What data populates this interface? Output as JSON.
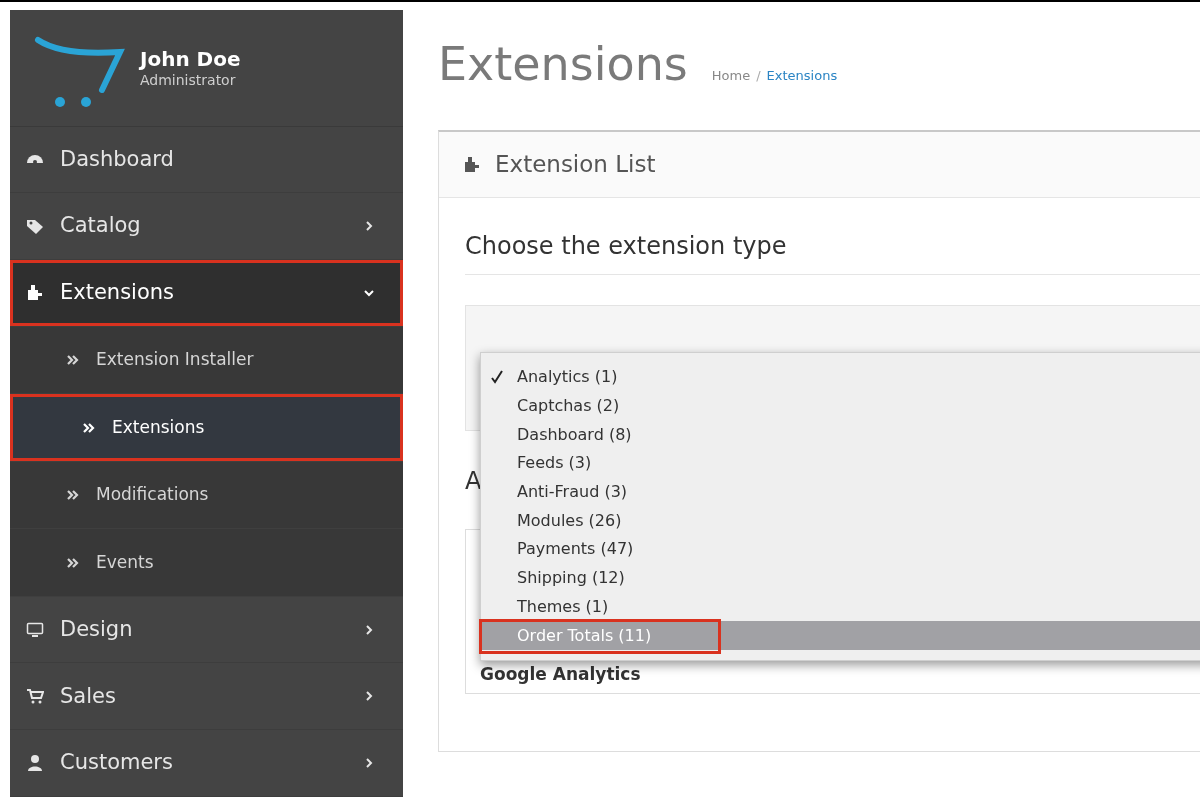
{
  "user": {
    "name": "John Doe",
    "role": "Administrator"
  },
  "sidebar": {
    "items": [
      {
        "label": "Dashboard",
        "kind": "plain",
        "annotated": false
      },
      {
        "label": "Catalog",
        "kind": "menu",
        "expanded": false,
        "annotated": false
      },
      {
        "label": "Extensions",
        "kind": "menu",
        "expanded": true,
        "annotated": true,
        "children": [
          {
            "label": "Extension Installer",
            "selected": false,
            "annotated": false
          },
          {
            "label": "Extensions",
            "selected": true,
            "annotated": true
          },
          {
            "label": "Modifications",
            "selected": false,
            "annotated": false
          },
          {
            "label": "Events",
            "selected": false,
            "annotated": false
          }
        ]
      },
      {
        "label": "Design",
        "kind": "menu",
        "expanded": false,
        "annotated": false
      },
      {
        "label": "Sales",
        "kind": "menu",
        "expanded": false,
        "annotated": false
      },
      {
        "label": "Customers",
        "kind": "menu",
        "expanded": false,
        "annotated": false
      }
    ]
  },
  "page": {
    "title": "Extensions",
    "breadcrumb_separator": "/",
    "breadcrumb": [
      {
        "label": "Home",
        "current": false
      },
      {
        "label": "Extensions",
        "current": true
      }
    ]
  },
  "panel": {
    "title": "Extension List",
    "section_title": "Choose the extension type",
    "hidden_heading": "A",
    "hidden_row": "Google Analytics"
  },
  "dropdown": {
    "options": [
      {
        "label": "Analytics (1)",
        "checked": true,
        "selected": false,
        "annotated": false
      },
      {
        "label": "Captchas (2)",
        "checked": false,
        "selected": false,
        "annotated": false
      },
      {
        "label": "Dashboard (8)",
        "checked": false,
        "selected": false,
        "annotated": false
      },
      {
        "label": "Feeds (3)",
        "checked": false,
        "selected": false,
        "annotated": false
      },
      {
        "label": "Anti-Fraud (3)",
        "checked": false,
        "selected": false,
        "annotated": false
      },
      {
        "label": "Modules (26)",
        "checked": false,
        "selected": false,
        "annotated": false
      },
      {
        "label": "Payments (47)",
        "checked": false,
        "selected": false,
        "annotated": false
      },
      {
        "label": "Shipping (12)",
        "checked": false,
        "selected": false,
        "annotated": false
      },
      {
        "label": "Themes (1)",
        "checked": false,
        "selected": false,
        "annotated": false
      },
      {
        "label": "Order Totals (11)",
        "checked": false,
        "selected": true,
        "annotated": true
      }
    ]
  }
}
